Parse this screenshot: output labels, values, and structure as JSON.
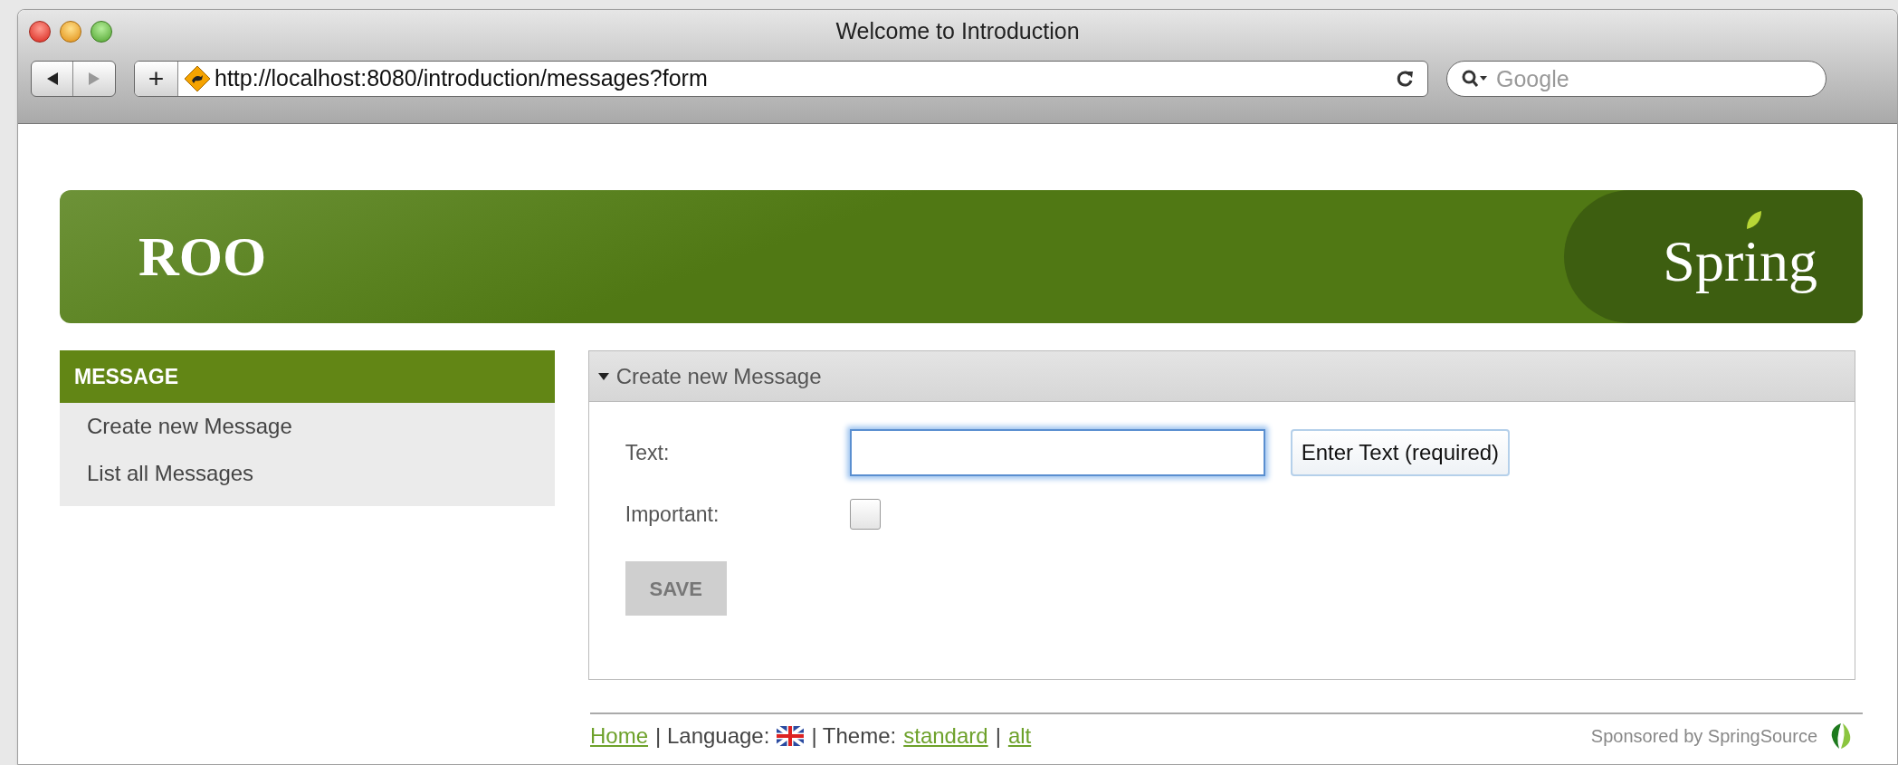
{
  "window": {
    "title": "Welcome to Introduction"
  },
  "toolbar": {
    "add_label": "+",
    "url": "http://localhost:8080/introduction/messages?form",
    "search": {
      "placeholder": "Google"
    }
  },
  "header": {
    "logo": "ROO",
    "brand": "Spring"
  },
  "sidebar": {
    "heading": "MESSAGE",
    "items": [
      {
        "label": "Create new Message"
      },
      {
        "label": "List all Messages"
      }
    ]
  },
  "panel": {
    "title": "Create new Message",
    "expanded": true,
    "fields": [
      {
        "kind": "text",
        "label": "Text:",
        "focused": true,
        "tooltip": "Enter Text (required)"
      },
      {
        "kind": "checkbox",
        "label": "Important:",
        "checked": false
      }
    ],
    "button": {
      "label": "SAVE",
      "disabled": true
    }
  },
  "footer": {
    "home": "Home",
    "language_label": "| Language:",
    "theme_label": "| Theme:",
    "themes": [
      {
        "label": "standard"
      },
      {
        "label": "alt"
      }
    ],
    "separator": "|",
    "sponsor": "Sponsored by SpringSource"
  }
}
